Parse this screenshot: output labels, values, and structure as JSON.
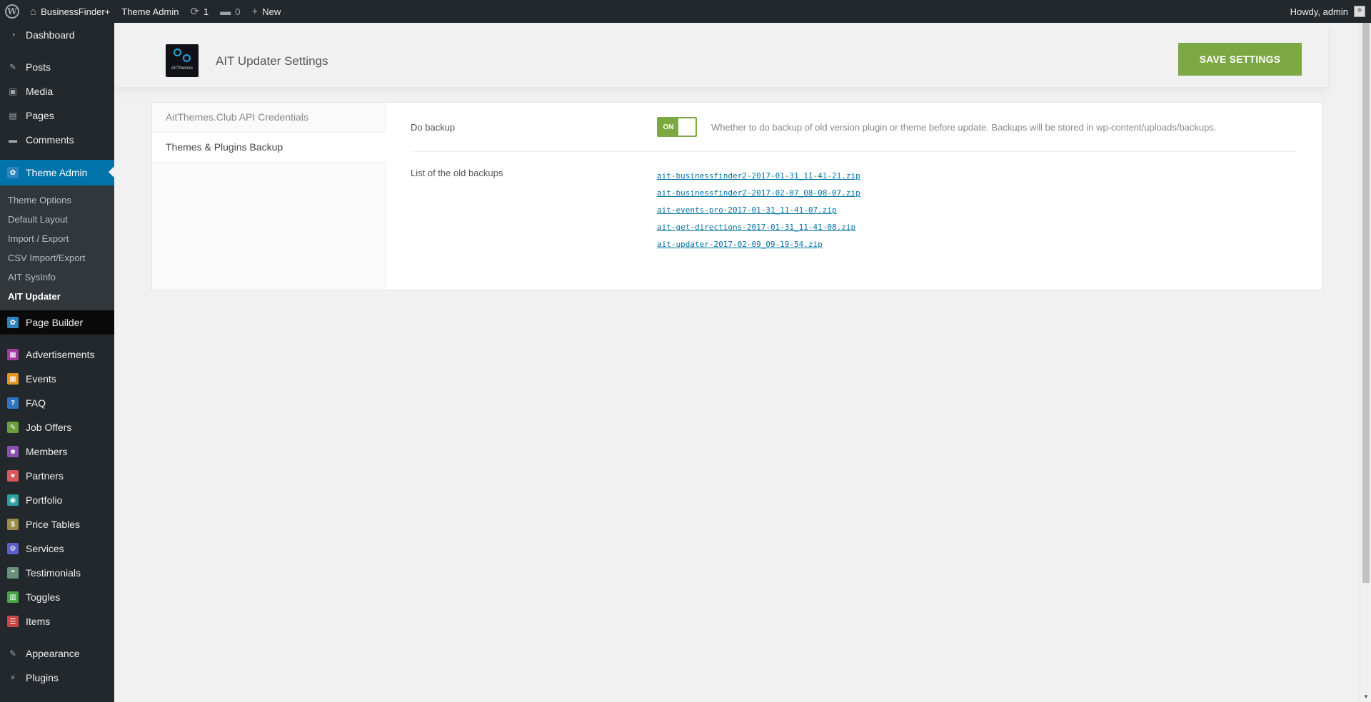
{
  "adminbar": {
    "site_name": "BusinessFinder+",
    "theme_admin": "Theme Admin",
    "updates_count": "1",
    "comments_count": "0",
    "new_label": "New",
    "greeting": "Howdy, admin"
  },
  "sidebar": {
    "dashboard": "Dashboard",
    "posts": "Posts",
    "media": "Media",
    "pages": "Pages",
    "comments": "Comments",
    "theme_admin": "Theme Admin",
    "submenu": [
      "Theme Options",
      "Default Layout",
      "Import / Export",
      "CSV Import/Export",
      "AIT SysInfo",
      "AIT Updater"
    ],
    "page_builder": "Page Builder",
    "items": [
      {
        "label": "Advertisements",
        "color": "#a23a9c"
      },
      {
        "label": "Events",
        "color": "#e0961f"
      },
      {
        "label": "FAQ",
        "color": "#2d74c1"
      },
      {
        "label": "Job Offers",
        "color": "#6e9f3a"
      },
      {
        "label": "Members",
        "color": "#8a4fb0"
      },
      {
        "label": "Partners",
        "color": "#d9575f"
      },
      {
        "label": "Portfolio",
        "color": "#2fa0a0"
      },
      {
        "label": "Price Tables",
        "color": "#9b8d4a"
      },
      {
        "label": "Services",
        "color": "#5b5fc7"
      },
      {
        "label": "Testimonials",
        "color": "#6b8f7a"
      },
      {
        "label": "Toggles",
        "color": "#4aa34a"
      },
      {
        "label": "Items",
        "color": "#c74747"
      }
    ],
    "appearance": "Appearance",
    "plugins": "Plugins"
  },
  "header": {
    "logo_text": "AitThemes",
    "title": "AIT Updater Settings",
    "save_label": "SAVE SETTINGS"
  },
  "tabs": [
    "AitThemes.Club API Credentials",
    "Themes & Plugins Backup"
  ],
  "options": {
    "do_backup_label": "Do backup",
    "toggle_on": "ON",
    "help": "Whether to do backup of old version plugin or theme before update. Backups will be stored in wp-content/uploads/backups.",
    "backups_label": "List of the old backups",
    "backups": [
      "ait-businessfinder2-2017-01-31_11-41-21.zip",
      "ait-businessfinder2-2017-02-07_08-08-07.zip",
      "ait-events-pro-2017-01-31_11-41-07.zip",
      "ait-get-directions-2017-01-31_11-41-08.zip",
      "ait-updater-2017-02-09_09-19-54.zip"
    ]
  }
}
